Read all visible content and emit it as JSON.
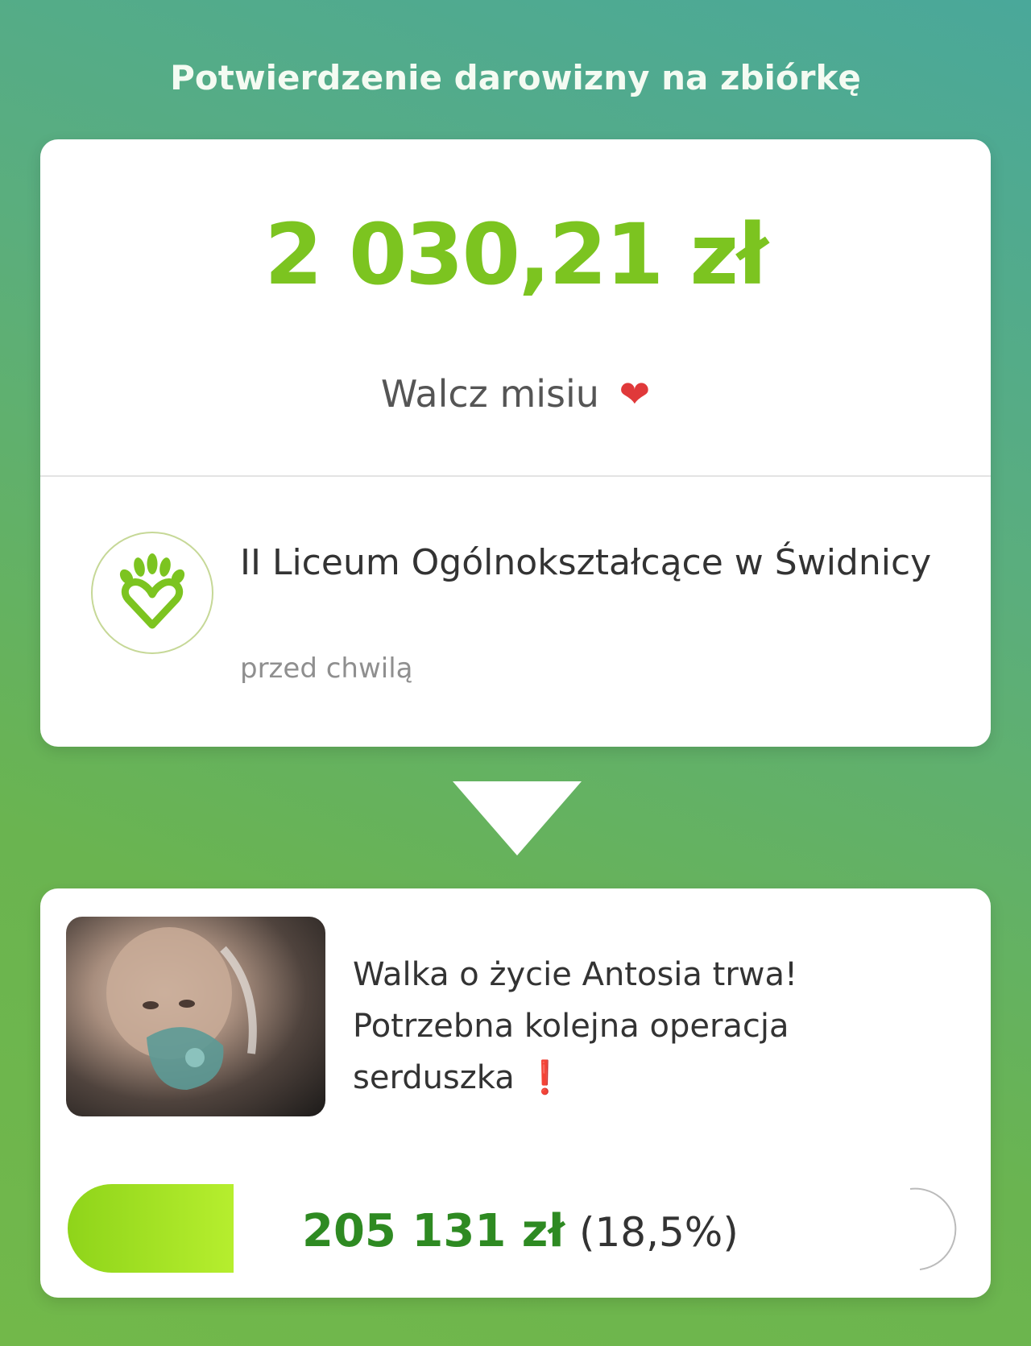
{
  "header": {
    "title": "Potwierdzenie darowizny na zbiórkę"
  },
  "donation": {
    "amount": "2 030,21 zł",
    "message": "Walcz misiu",
    "message_emoji": "❤",
    "donor_name": "II Liceum Ogólnokształcące w Świdnicy",
    "donor_time": "przed chwilą",
    "donor_logo_icon": "hand-heart-logo-icon"
  },
  "arrow_icon": "arrow-down-icon",
  "campaign": {
    "title": "Walka o życie Antosia trwa! Potrzebna kolejna operacja serduszka",
    "title_emoji": "❗",
    "raised_amount": "205 131 zł",
    "raised_percent": "(18,5%)",
    "progress_fraction": 0.185
  },
  "colors": {
    "amount_green": "#7cc420",
    "raised_green": "#2e8a22",
    "heart_red": "#e0393a",
    "logo_green": "#7cc420"
  }
}
